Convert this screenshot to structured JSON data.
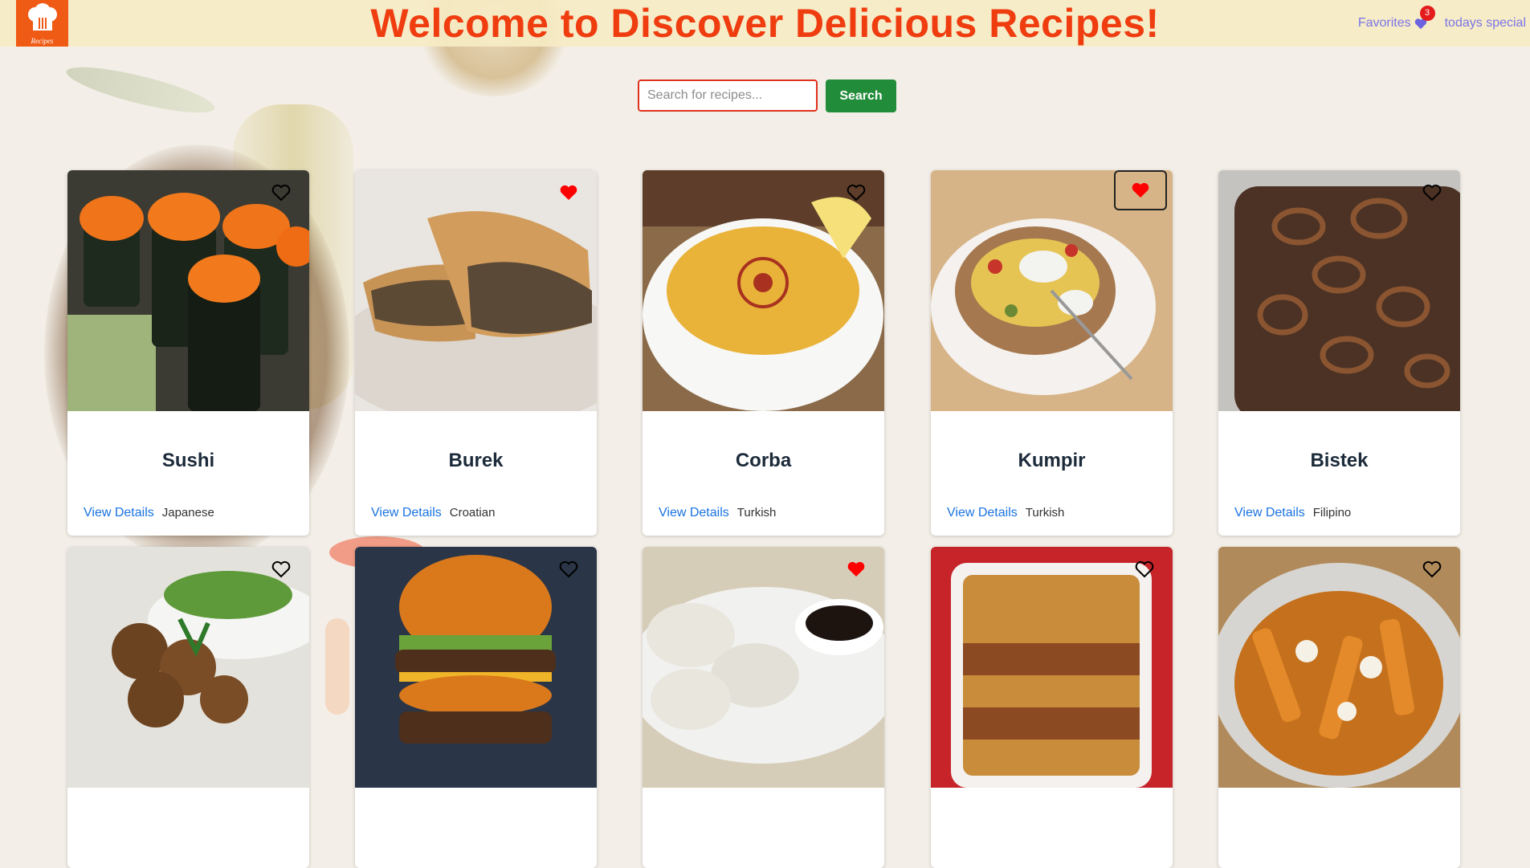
{
  "header": {
    "logo_text": "Recipes",
    "headline": "Welcome to Discover Delicious Recipes!",
    "nav": {
      "favorites_label": "Favorites",
      "favorites_count": "3",
      "special_label": "todays special"
    }
  },
  "search": {
    "placeholder": "Search for recipes...",
    "button_label": "Search"
  },
  "detail_label": "View Details",
  "recipes": [
    {
      "name": "Sushi",
      "cuisine": "Japanese",
      "favorited": false
    },
    {
      "name": "Burek",
      "cuisine": "Croatian",
      "favorited": true
    },
    {
      "name": "Corba",
      "cuisine": "Turkish",
      "favorited": false
    },
    {
      "name": "Kumpir",
      "cuisine": "Turkish",
      "favorited": true
    },
    {
      "name": "Bistek",
      "cuisine": "Filipino",
      "favorited": false
    },
    {
      "favorited": false
    },
    {
      "favorited": false
    },
    {
      "favorited": true
    },
    {
      "favorited": false
    },
    {
      "favorited": false
    }
  ],
  "colors": {
    "accent": "#ef3d10",
    "favorite": "#ff0000",
    "link": "#1a73e0",
    "nav_link": "#7a73e6",
    "search_button": "#218c3a"
  }
}
